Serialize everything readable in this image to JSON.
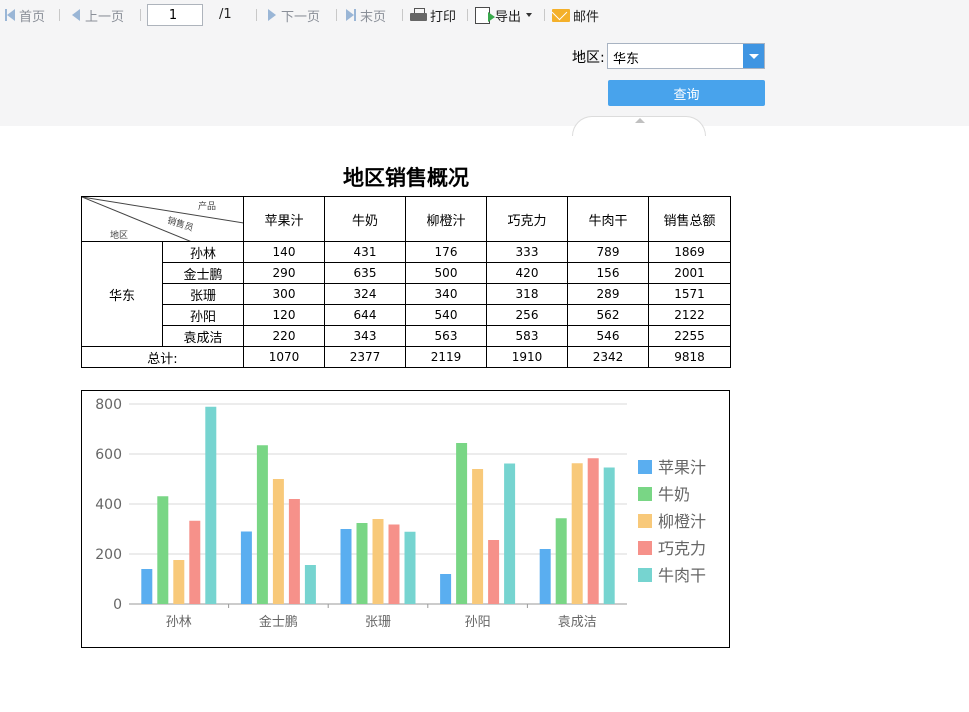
{
  "toolbar": {
    "first_label": "首页",
    "prev_label": "上一页",
    "page_value": "1",
    "page_total": "/1",
    "next_label": "下一页",
    "last_label": "末页",
    "print_label": "打印",
    "export_label": "导出",
    "mail_label": "邮件"
  },
  "params": {
    "region_label": "地区:",
    "region_value": "华东",
    "query_label": "查询"
  },
  "report": {
    "title": "地区销售概况",
    "corner": {
      "product": "产品",
      "salesperson": "销售员",
      "region": "地区"
    },
    "columns": [
      "苹果汁",
      "牛奶",
      "柳橙汁",
      "巧克力",
      "牛肉干",
      "销售总额"
    ],
    "region": "华东",
    "rows": [
      {
        "name": "孙林",
        "values": [
          "140",
          "431",
          "176",
          "333",
          "789",
          "1869"
        ]
      },
      {
        "name": "金士鹏",
        "values": [
          "290",
          "635",
          "500",
          "420",
          "156",
          "2001"
        ]
      },
      {
        "name": "张珊",
        "values": [
          "300",
          "324",
          "340",
          "318",
          "289",
          "1571"
        ]
      },
      {
        "name": "孙阳",
        "values": [
          "120",
          "644",
          "540",
          "256",
          "562",
          "2122"
        ]
      },
      {
        "name": "袁成洁",
        "values": [
          "220",
          "343",
          "563",
          "583",
          "546",
          "2255"
        ]
      }
    ],
    "total_label": "总计:",
    "totals": [
      "1070",
      "2377",
      "2119",
      "1910",
      "2342",
      "9818"
    ]
  },
  "chart_data": {
    "type": "bar",
    "categories": [
      "孙林",
      "金士鹏",
      "张珊",
      "孙阳",
      "袁成洁"
    ],
    "series": [
      {
        "name": "苹果汁",
        "values": [
          140,
          290,
          300,
          120,
          220
        ],
        "color": "#5aaef0"
      },
      {
        "name": "牛奶",
        "values": [
          431,
          635,
          324,
          644,
          343
        ],
        "color": "#79d685"
      },
      {
        "name": "柳橙汁",
        "values": [
          176,
          500,
          340,
          540,
          563
        ],
        "color": "#f8c97a"
      },
      {
        "name": "巧克力",
        "values": [
          333,
          420,
          318,
          256,
          583
        ],
        "color": "#f6918a"
      },
      {
        "name": "牛肉干",
        "values": [
          789,
          156,
          289,
          562,
          546
        ],
        "color": "#76d4d0"
      }
    ],
    "ylim": [
      0,
      800
    ],
    "yticks": [
      0,
      200,
      400,
      600,
      800
    ],
    "grid": true,
    "legend": "right"
  }
}
